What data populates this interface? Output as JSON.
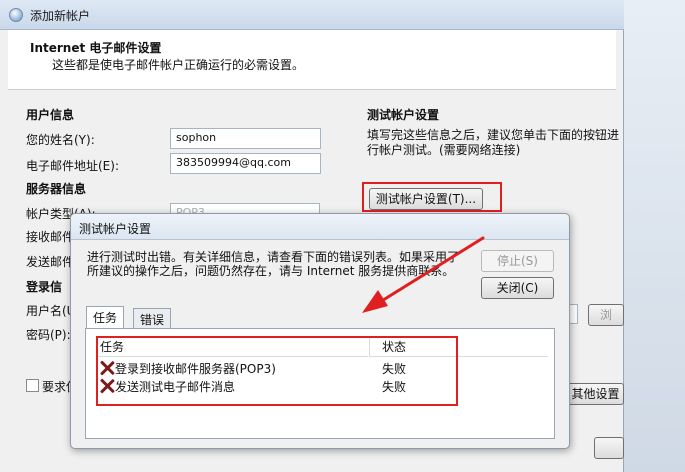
{
  "window": {
    "title": "添加新帐户",
    "header_title": "Internet 电子邮件设置",
    "header_subtitle": "这些都是使电子邮件帐户正确运行的必需设置。"
  },
  "user_info": {
    "section_title": "用户信息",
    "name_label": "您的姓名(Y):",
    "name_value": "sophon",
    "email_label": "电子邮件地址(E):",
    "email_value": "383509994@qq.com"
  },
  "server_info": {
    "section_title": "服务器信息",
    "account_type_label": "帐户类型(A):",
    "account_type_value": "POP3",
    "incoming_label": "接收邮件",
    "outgoing_label": "发送邮件"
  },
  "login_info": {
    "section_title": "登录信",
    "username_label": "用户名(U",
    "password_label": "密码(P):",
    "remember_label": "要求使"
  },
  "test_settings": {
    "section_title": "测试帐户设置",
    "description": "填写完这些信息之后，建议您单击下面的按钮进行帐户测试。(需要网络连接)",
    "test_button": "测试帐户设置(T)...",
    "more_settings_button": "其他设置",
    "partial_button": "浏"
  },
  "dialog": {
    "title": "测试帐户设置",
    "message": "进行测试时出错。有关详细信息，请查看下面的错误列表。如果采用了所建议的操作之后，问题仍然存在，请与 Internet 服务提供商联系。",
    "stop_button": "停止(S)",
    "close_button": "关闭(C)",
    "tabs": [
      {
        "label": "任务"
      },
      {
        "label": "错误"
      }
    ],
    "columns": {
      "task": "任务",
      "status": "状态"
    },
    "tasks": [
      {
        "name": "登录到接收邮件服务器(POP3)",
        "status": "失败"
      },
      {
        "name": "发送测试电子邮件消息",
        "status": "失败"
      }
    ]
  },
  "colors": {
    "highlight_red": "#e02020",
    "fail_icon": "#7a1b1b"
  }
}
